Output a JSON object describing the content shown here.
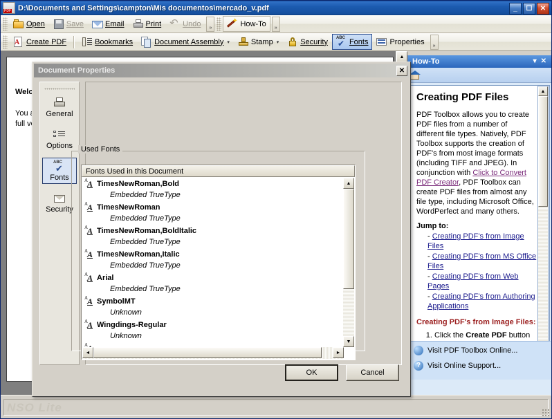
{
  "window": {
    "title": "D:\\Documents and Settings\\campton\\Mis documentos\\mercado_v.pdf",
    "icon": "pdf-document-icon",
    "minimize_label": "_",
    "maximize_label": "☐",
    "close_label": "✕"
  },
  "toolbar1": {
    "buttons": [
      {
        "label": "Open",
        "icon": "open-folder-icon",
        "state": "enabled"
      },
      {
        "label": "Save",
        "icon": "floppy-disk-icon",
        "state": "disabled"
      },
      {
        "label": "Email",
        "icon": "envelope-icon",
        "state": "enabled"
      },
      {
        "label": "Print",
        "icon": "printer-icon",
        "state": "enabled"
      },
      {
        "label": "Undo",
        "icon": "undo-arrow-icon",
        "state": "disabled"
      }
    ],
    "howto": {
      "label": "How-To",
      "icon": "magic-wand-icon"
    },
    "overflow_label": "»"
  },
  "toolbar2": {
    "buttons": [
      {
        "label": "Create PDF",
        "icon": "create-pdf-icon",
        "dropdown": false,
        "selected": false
      },
      {
        "label": "Bookmarks",
        "icon": "bookmarks-icon",
        "dropdown": false,
        "selected": false
      },
      {
        "label": "Document Assembly",
        "icon": "document-assembly-icon",
        "dropdown": true,
        "selected": false
      },
      {
        "label": "Stamp",
        "icon": "stamp-icon",
        "dropdown": true,
        "selected": false
      },
      {
        "label": "Security",
        "icon": "padlock-icon",
        "dropdown": false,
        "selected": false
      },
      {
        "label": "Fonts",
        "icon": "fonts-check-icon",
        "dropdown": false,
        "selected": true
      },
      {
        "label": "Properties",
        "icon": "properties-icon",
        "dropdown": false,
        "selected": false
      }
    ],
    "dropdown_caret": "▾",
    "overflow_label": "»"
  },
  "document": {
    "heading": "Welcome",
    "line1": "You are",
    "line2": "full version"
  },
  "dialog": {
    "title": "Document Properties",
    "close_label": "✕",
    "nav": [
      {
        "label": "General",
        "icon": "printer-page-icon",
        "active": false
      },
      {
        "label": "Options",
        "icon": "list-options-icon",
        "active": false
      },
      {
        "label": "Fonts",
        "icon": "fonts-check-icon",
        "active": true
      },
      {
        "label": "Security",
        "icon": "envelope-icon",
        "active": false
      }
    ],
    "group_label": "Used Fonts",
    "list_header": "Fonts Used in this Document",
    "fonts": [
      {
        "name": "TimesNewRoman,Bold",
        "type": "Embedded TrueType"
      },
      {
        "name": "TimesNewRoman",
        "type": "Embedded TrueType"
      },
      {
        "name": "TimesNewRoman,BoldItalic",
        "type": "Embedded TrueType"
      },
      {
        "name": "TimesNewRoman,Italic",
        "type": "Embedded TrueType"
      },
      {
        "name": "Arial",
        "type": "Embedded TrueType"
      },
      {
        "name": "SymbolMT",
        "type": "Unknown"
      },
      {
        "name": "Wingdings-Regular",
        "type": "Unknown"
      }
    ],
    "ok_label": "OK",
    "cancel_label": "Cancel",
    "scroll": {
      "up_arrow": "▲",
      "down_arrow": "▼",
      "left_arrow": "◄",
      "right_arrow": "►"
    }
  },
  "howto": {
    "title": "How-To",
    "menu_label": "▾",
    "close_label": "✕",
    "home_icon": "home-icon",
    "heading": "Creating PDF Files",
    "intro_part1": "PDF Toolbox allows you to create PDF files from a number of different file types.  Natively, PDF Toolbox supports the creation of PDF's from most image formats (including TIFF and JPEG).  In conjunction with ",
    "intro_link": "Click to Convert PDF Creator",
    "intro_part2": ", PDF Toolbox can create PDF files from almost any file type, including Microsoft Office, WordPerfect and many others.",
    "jump_heading": "Jump to:",
    "jump_links": [
      "Creating PDF's from Image Files",
      "Creating PDF's from MS Office Files",
      "Creating PDF's from Web Pages",
      "Creating PDF's from Authoring Applications"
    ],
    "section_heading": "Creating PDF's from Image Files:",
    "step1_pre": "Click the ",
    "step1_bold": "Create PDF",
    "step1_post": " button to open the Create PDF window.",
    "bottom_links": [
      {
        "label": "Visit PDF Toolbox Online...",
        "icon": "globe-icon"
      },
      {
        "label": "Visit Online Support...",
        "icon": "help-circle-icon"
      }
    ],
    "scroll": {
      "up_arrow": "▲",
      "down_arrow": "▼"
    }
  },
  "statusbar": {
    "watermark": "NSO Lite"
  },
  "colors": {
    "titlebar_blue": "#1c5bb0",
    "dialog_face": "#d4d0c8",
    "selected_accent": "#2a4d8f",
    "howto_panel": "#dceaf8",
    "link_purple": "#7a2a7a",
    "link_blue": "#1a1a8c",
    "section_red": "#9c2020"
  }
}
